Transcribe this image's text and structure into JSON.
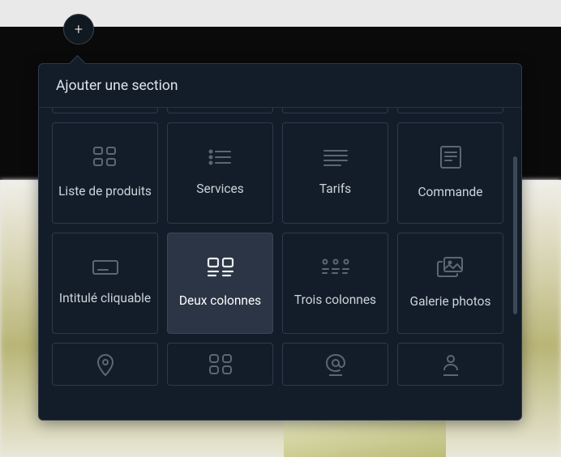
{
  "popover": {
    "title": "Ajouter une section"
  },
  "tiles": {
    "product_list": "Liste de produits",
    "services": "Services",
    "pricing": "Tarifs",
    "order": "Commande",
    "clickable_title": "Intitulé cliquable",
    "two_columns": "Deux colonnes",
    "three_columns": "Trois colonnes",
    "photo_gallery": "Galerie photos"
  },
  "fab": "+"
}
